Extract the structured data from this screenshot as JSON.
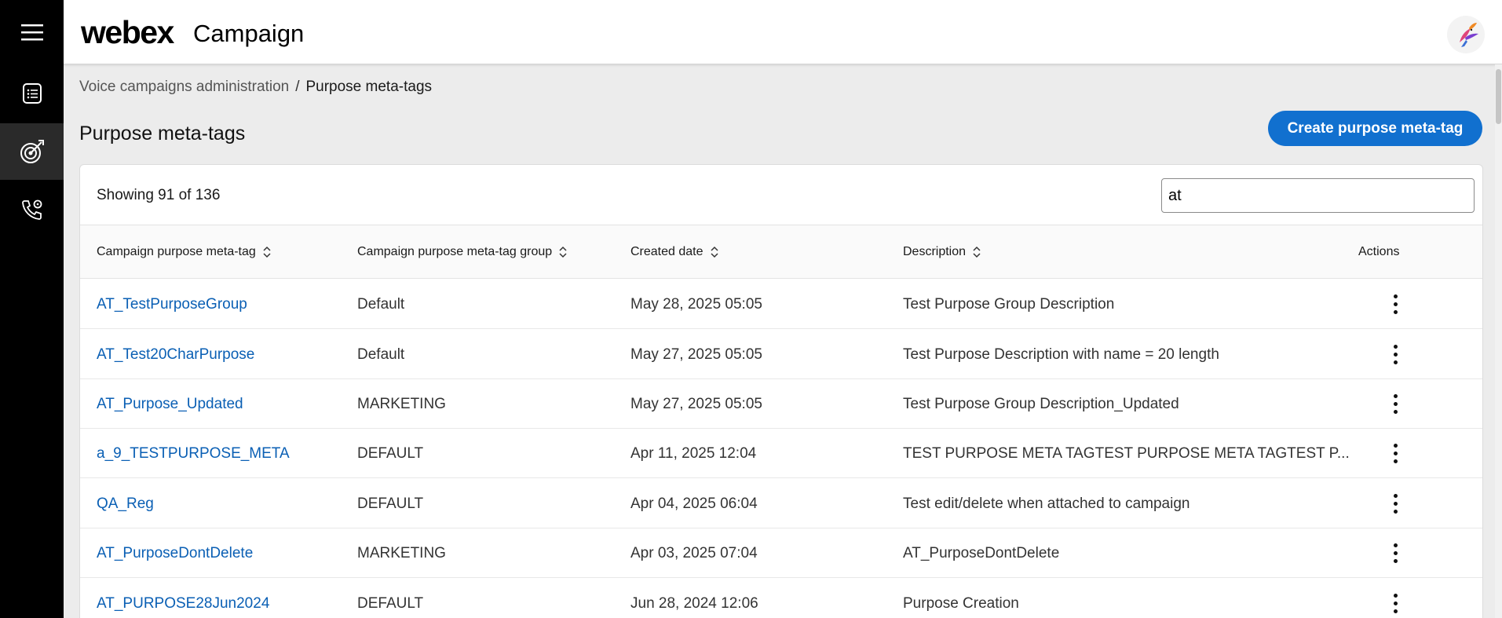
{
  "app": {
    "brand": "webex",
    "product": "Campaign"
  },
  "sidebar": {
    "items": [
      {
        "name": "menu",
        "icon": "hamburger-menu-icon"
      },
      {
        "name": "list",
        "icon": "list-icon"
      },
      {
        "name": "campaigns",
        "icon": "target-icon",
        "active": true
      },
      {
        "name": "voice",
        "icon": "phone-settings-icon"
      }
    ]
  },
  "breadcrumb": {
    "parent": "Voice campaigns administration",
    "separator": "/",
    "current": "Purpose meta-tags"
  },
  "page": {
    "title": "Purpose meta-tags",
    "create_label": "Create purpose meta-tag"
  },
  "toolbar": {
    "showing": "Showing 91 of 136",
    "search_value": "at"
  },
  "table": {
    "headers": [
      "Campaign purpose meta-tag",
      "Campaign purpose meta-tag group",
      "Created date",
      "Description",
      "Actions"
    ],
    "rows": [
      {
        "tag": "AT_TestPurposeGroup",
        "group": "Default",
        "date": "May 28, 2025 05:05",
        "description": "Test Purpose Group Description"
      },
      {
        "tag": "AT_Test20CharPurpose",
        "group": "Default",
        "date": "May 27, 2025 05:05",
        "description": "Test Purpose Description with name = 20 length"
      },
      {
        "tag": "AT_Purpose_Updated",
        "group": "MARKETING",
        "date": "May 27, 2025 05:05",
        "description": "Test Purpose Group Description_Updated"
      },
      {
        "tag": "a_9_TESTPURPOSE_META",
        "group": "DEFAULT",
        "date": "Apr 11, 2025 12:04",
        "description": "TEST PURPOSE META TAGTEST PURPOSE META TAGTEST P..."
      },
      {
        "tag": "QA_Reg",
        "group": "DEFAULT",
        "date": "Apr 04, 2025 06:04",
        "description": "Test edit/delete when attached to campaign"
      },
      {
        "tag": "AT_PurposeDontDelete",
        "group": "MARKETING",
        "date": "Apr 03, 2025 07:04",
        "description": "AT_PurposeDontDelete"
      },
      {
        "tag": "AT_PURPOSE28Jun2024",
        "group": "DEFAULT",
        "date": "Jun 28, 2024 12:06",
        "description": "Purpose Creation"
      }
    ]
  },
  "colors": {
    "primary": "#1170cf",
    "link": "#0a5fb4",
    "sidebar": "#000000"
  }
}
